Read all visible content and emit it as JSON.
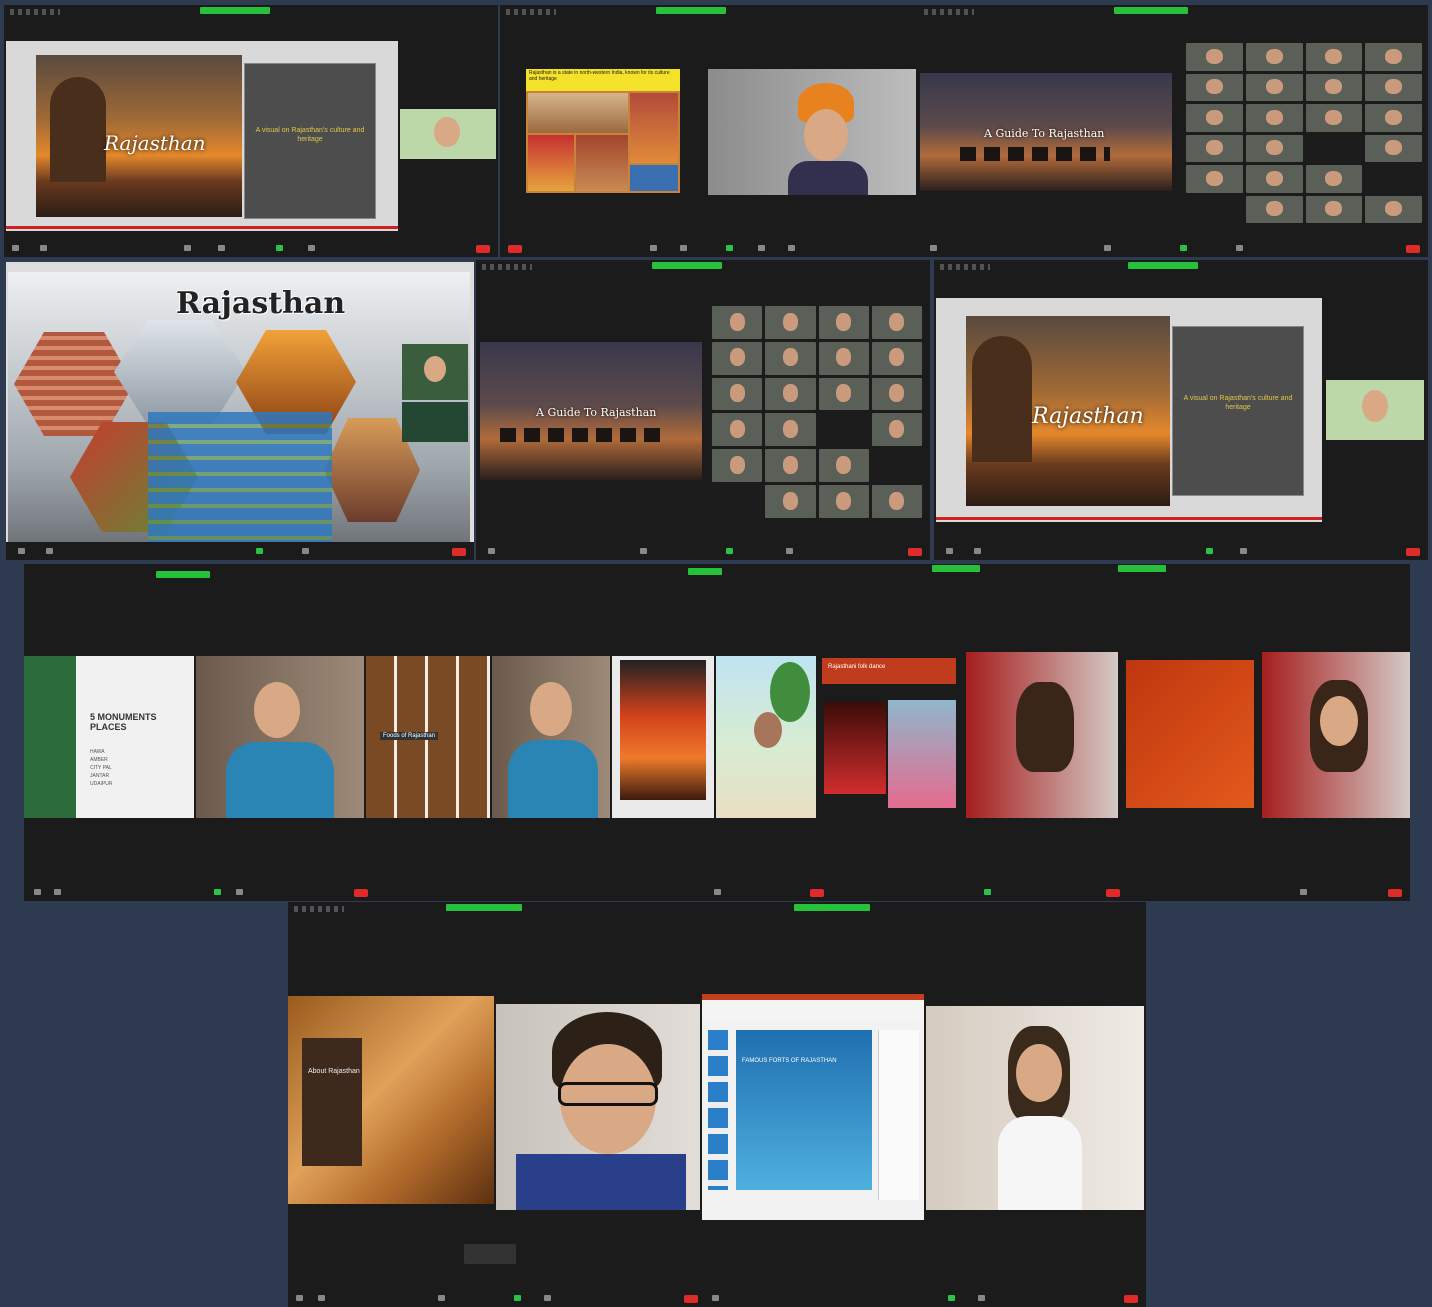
{
  "slides": {
    "rajasthan_script": "Rajasthan",
    "culture_heritage": "A visual on Rajasthan's culture and heritage",
    "guide_title": "A Guide To Rajasthan",
    "rajasthan_title": "Rajasthan",
    "monuments_title": "5 MONUMENTS PLACES",
    "monuments_list": [
      "HAWA",
      "AMBER",
      "CITY PAL",
      "JANTAR",
      "UDAIPUR"
    ],
    "food_caption": "Foods of Rajasthan",
    "dance_title": "Rajasthani folk dance",
    "dune_title": "About Rajasthan",
    "forts_title": "FAMOUS FORTS OF RAJASTHAN",
    "yellow_banner": "Rajasthan is a state in north-western India, known for its culture and heritage"
  },
  "colors": {
    "background": "#2e3a4f",
    "window": "#1b1b1b",
    "recording_bar": "#25c13a",
    "end_button": "#e02b2b"
  },
  "icons": [
    "mute-icon",
    "video-icon",
    "participants-icon",
    "chat-icon",
    "share-screen-icon",
    "record-icon",
    "end-call-icon"
  ]
}
